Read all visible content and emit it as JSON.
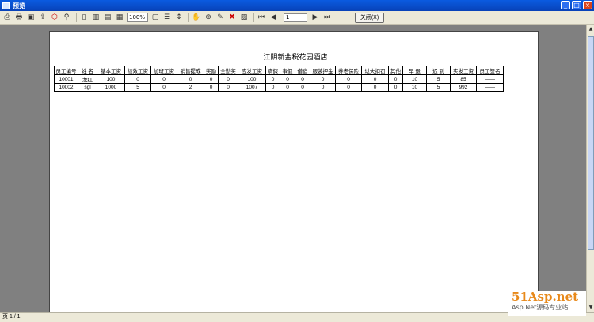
{
  "window": {
    "title": "预览"
  },
  "toolbar": {
    "zoom": "100%",
    "page_current": "1",
    "close_label": "关闭(X)"
  },
  "report": {
    "title": "江阴新金税花园酒店",
    "columns": [
      "员工编号",
      "姓 名",
      "基本工资",
      "绩效工资",
      "加班工资",
      "销售提成",
      "奖励",
      "全勤奖",
      "应发工资",
      "病假",
      "事假",
      "借宿",
      "服装押金",
      "养老保险",
      "过失扣罚",
      "其他",
      "早 退",
      "迟 到",
      "实发工资",
      "员工签名"
    ],
    "rows": [
      [
        "10001",
        "龙红",
        "100",
        "0",
        "0",
        "0",
        "0",
        "0",
        "100",
        "0",
        "0",
        "0",
        "0",
        "0",
        "0",
        "0",
        "10",
        "5",
        "85",
        "——"
      ],
      [
        "10002",
        "sgl",
        "1000",
        "5",
        "0",
        "2",
        "0",
        "0",
        "1007",
        "0",
        "0",
        "0",
        "0",
        "0",
        "0",
        "0",
        "10",
        "5",
        "992",
        "——"
      ]
    ]
  },
  "statusbar": {
    "text": "页 1 / 1"
  },
  "watermark": {
    "brand": "51Asp.net",
    "tagline": "Asp.Net源码专业站"
  }
}
